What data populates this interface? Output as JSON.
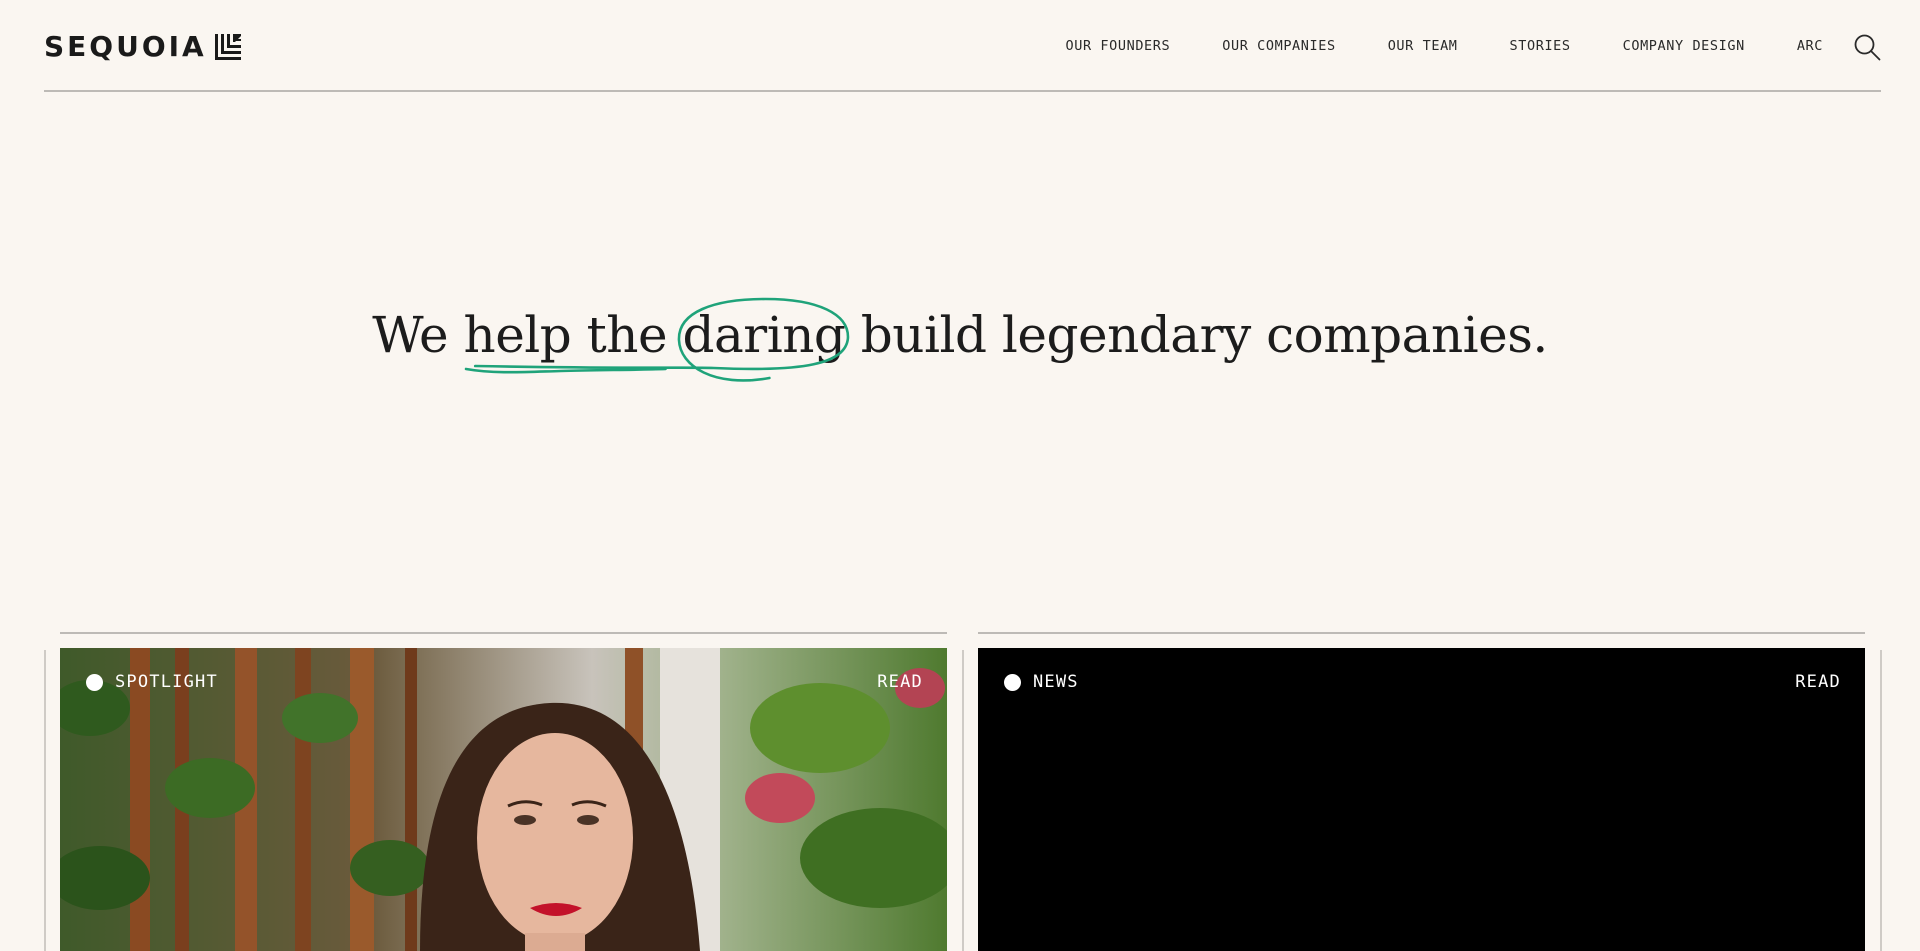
{
  "brand": {
    "name": "SEQUOIA"
  },
  "nav": {
    "items": [
      "OUR FOUNDERS",
      "OUR COMPANIES",
      "OUR TEAM",
      "STORIES",
      "COMPANY DESIGN",
      "ARC"
    ],
    "search_icon": "search-icon"
  },
  "hero": {
    "pre": "We ",
    "underlined": "help the",
    "space": " ",
    "circled": "daring",
    "post": " build legendary companies.",
    "accent_color": "#1fa37a"
  },
  "cards": [
    {
      "tag": "SPOTLIGHT",
      "action": "READ",
      "media": "photo"
    },
    {
      "tag": "NEWS",
      "action": "READ",
      "media": "black"
    }
  ],
  "colors": {
    "background": "#faf6f1",
    "text": "#1a1a1a",
    "rule": "#bdbab6",
    "accent": "#1fa37a"
  }
}
